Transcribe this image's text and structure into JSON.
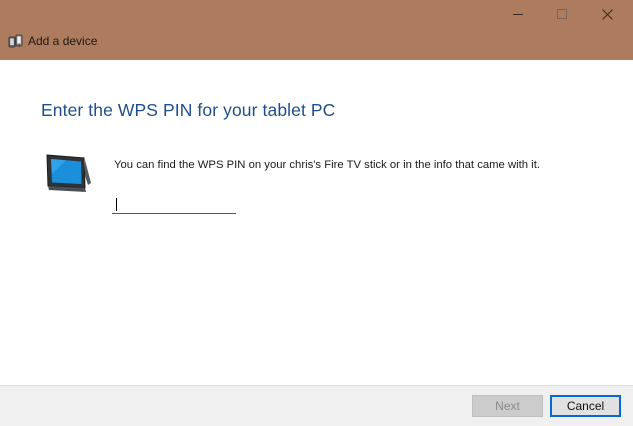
{
  "window": {
    "title": "Add a device",
    "title_icon": "add-device-icon",
    "titlebar_color": "#ad7b5e",
    "controls": [
      "minimize-icon",
      "maximize-icon",
      "close-icon"
    ]
  },
  "main": {
    "heading": "Enter the WPS PIN for your tablet PC",
    "device_icon": "tablet-icon",
    "info_text": "You can find the WPS PIN on your chris's Fire TV stick or in the info that came with it.",
    "pin_value": "",
    "heading_color": "#1e4f8c"
  },
  "footer": {
    "next_label": "Next",
    "next_enabled": false,
    "cancel_label": "Cancel"
  }
}
